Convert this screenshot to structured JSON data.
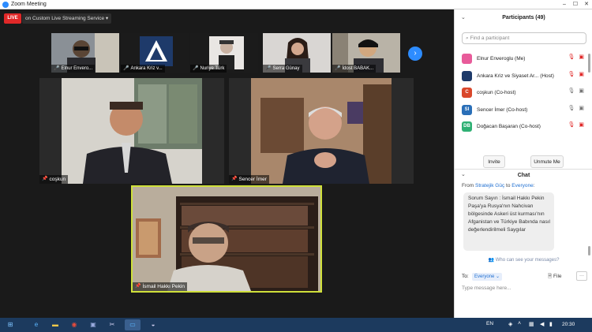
{
  "window": {
    "title": "Zoom Meeting"
  },
  "top_bar": {
    "live_label": "LIVE",
    "stream_label": "on Custom Live Streaming Service ▾"
  },
  "thumbnails": [
    {
      "name": "Elnur Envero..."
    },
    {
      "name": "Ankara Kriz v..."
    },
    {
      "name": "Nuriye Türk"
    },
    {
      "name": "Serra Günay"
    },
    {
      "name": "İdost BABAK..."
    }
  ],
  "tiles": [
    {
      "name": "coşkun"
    },
    {
      "name": "Sencer İmer"
    },
    {
      "name": "İsmail Hakkı Pekin"
    }
  ],
  "participants": {
    "header": "Participants (49)",
    "search_placeholder": "Find a participant",
    "items": [
      {
        "initials": "",
        "name": "Elnur Enveroglu (Me)",
        "color": "#e85b9a"
      },
      {
        "initials": "",
        "name": "Ankara Kriz ve Siyaset Ar... (Host)",
        "color": "#1e3a6a"
      },
      {
        "initials": "C",
        "name": "coşkun (Co-host)",
        "color": "#d9472b"
      },
      {
        "initials": "SI",
        "name": "Sencer İmer (Co-host)",
        "color": "#2a6fb8"
      },
      {
        "initials": "DB",
        "name": "Doğacan Başaran (Co-host)",
        "color": "#2fb074"
      }
    ],
    "invite_label": "Invite",
    "unmute_label": "Unmute Me"
  },
  "chat": {
    "header": "Chat",
    "from_prefix": "From ",
    "from_name": "Stratejik Güç",
    "to_word": " to ",
    "to_name": "Everyone",
    "colon": ":",
    "message": "Sorum Sayın : İsmail Hakkı Pekin Paşa'ya Rusya'nın Nahcivan bölgesinde Askeri üst kurması'nın Afganistan ve Türkiye Babında nasıl değerlendirilmeli Saygılar",
    "who_can_see": "Who can see your messages?",
    "to_label": "To:",
    "recipient": "Everyone ⌄",
    "file_label": "File",
    "more_label": "···",
    "input_placeholder": "Type message here..."
  },
  "taskbar": {
    "lang": "EN",
    "time": "20:30"
  },
  "colors": {
    "live": "#e02828",
    "accent": "#2d8cff",
    "speaker_border": "#cfe03a",
    "taskbar": "#1c3a5e"
  }
}
